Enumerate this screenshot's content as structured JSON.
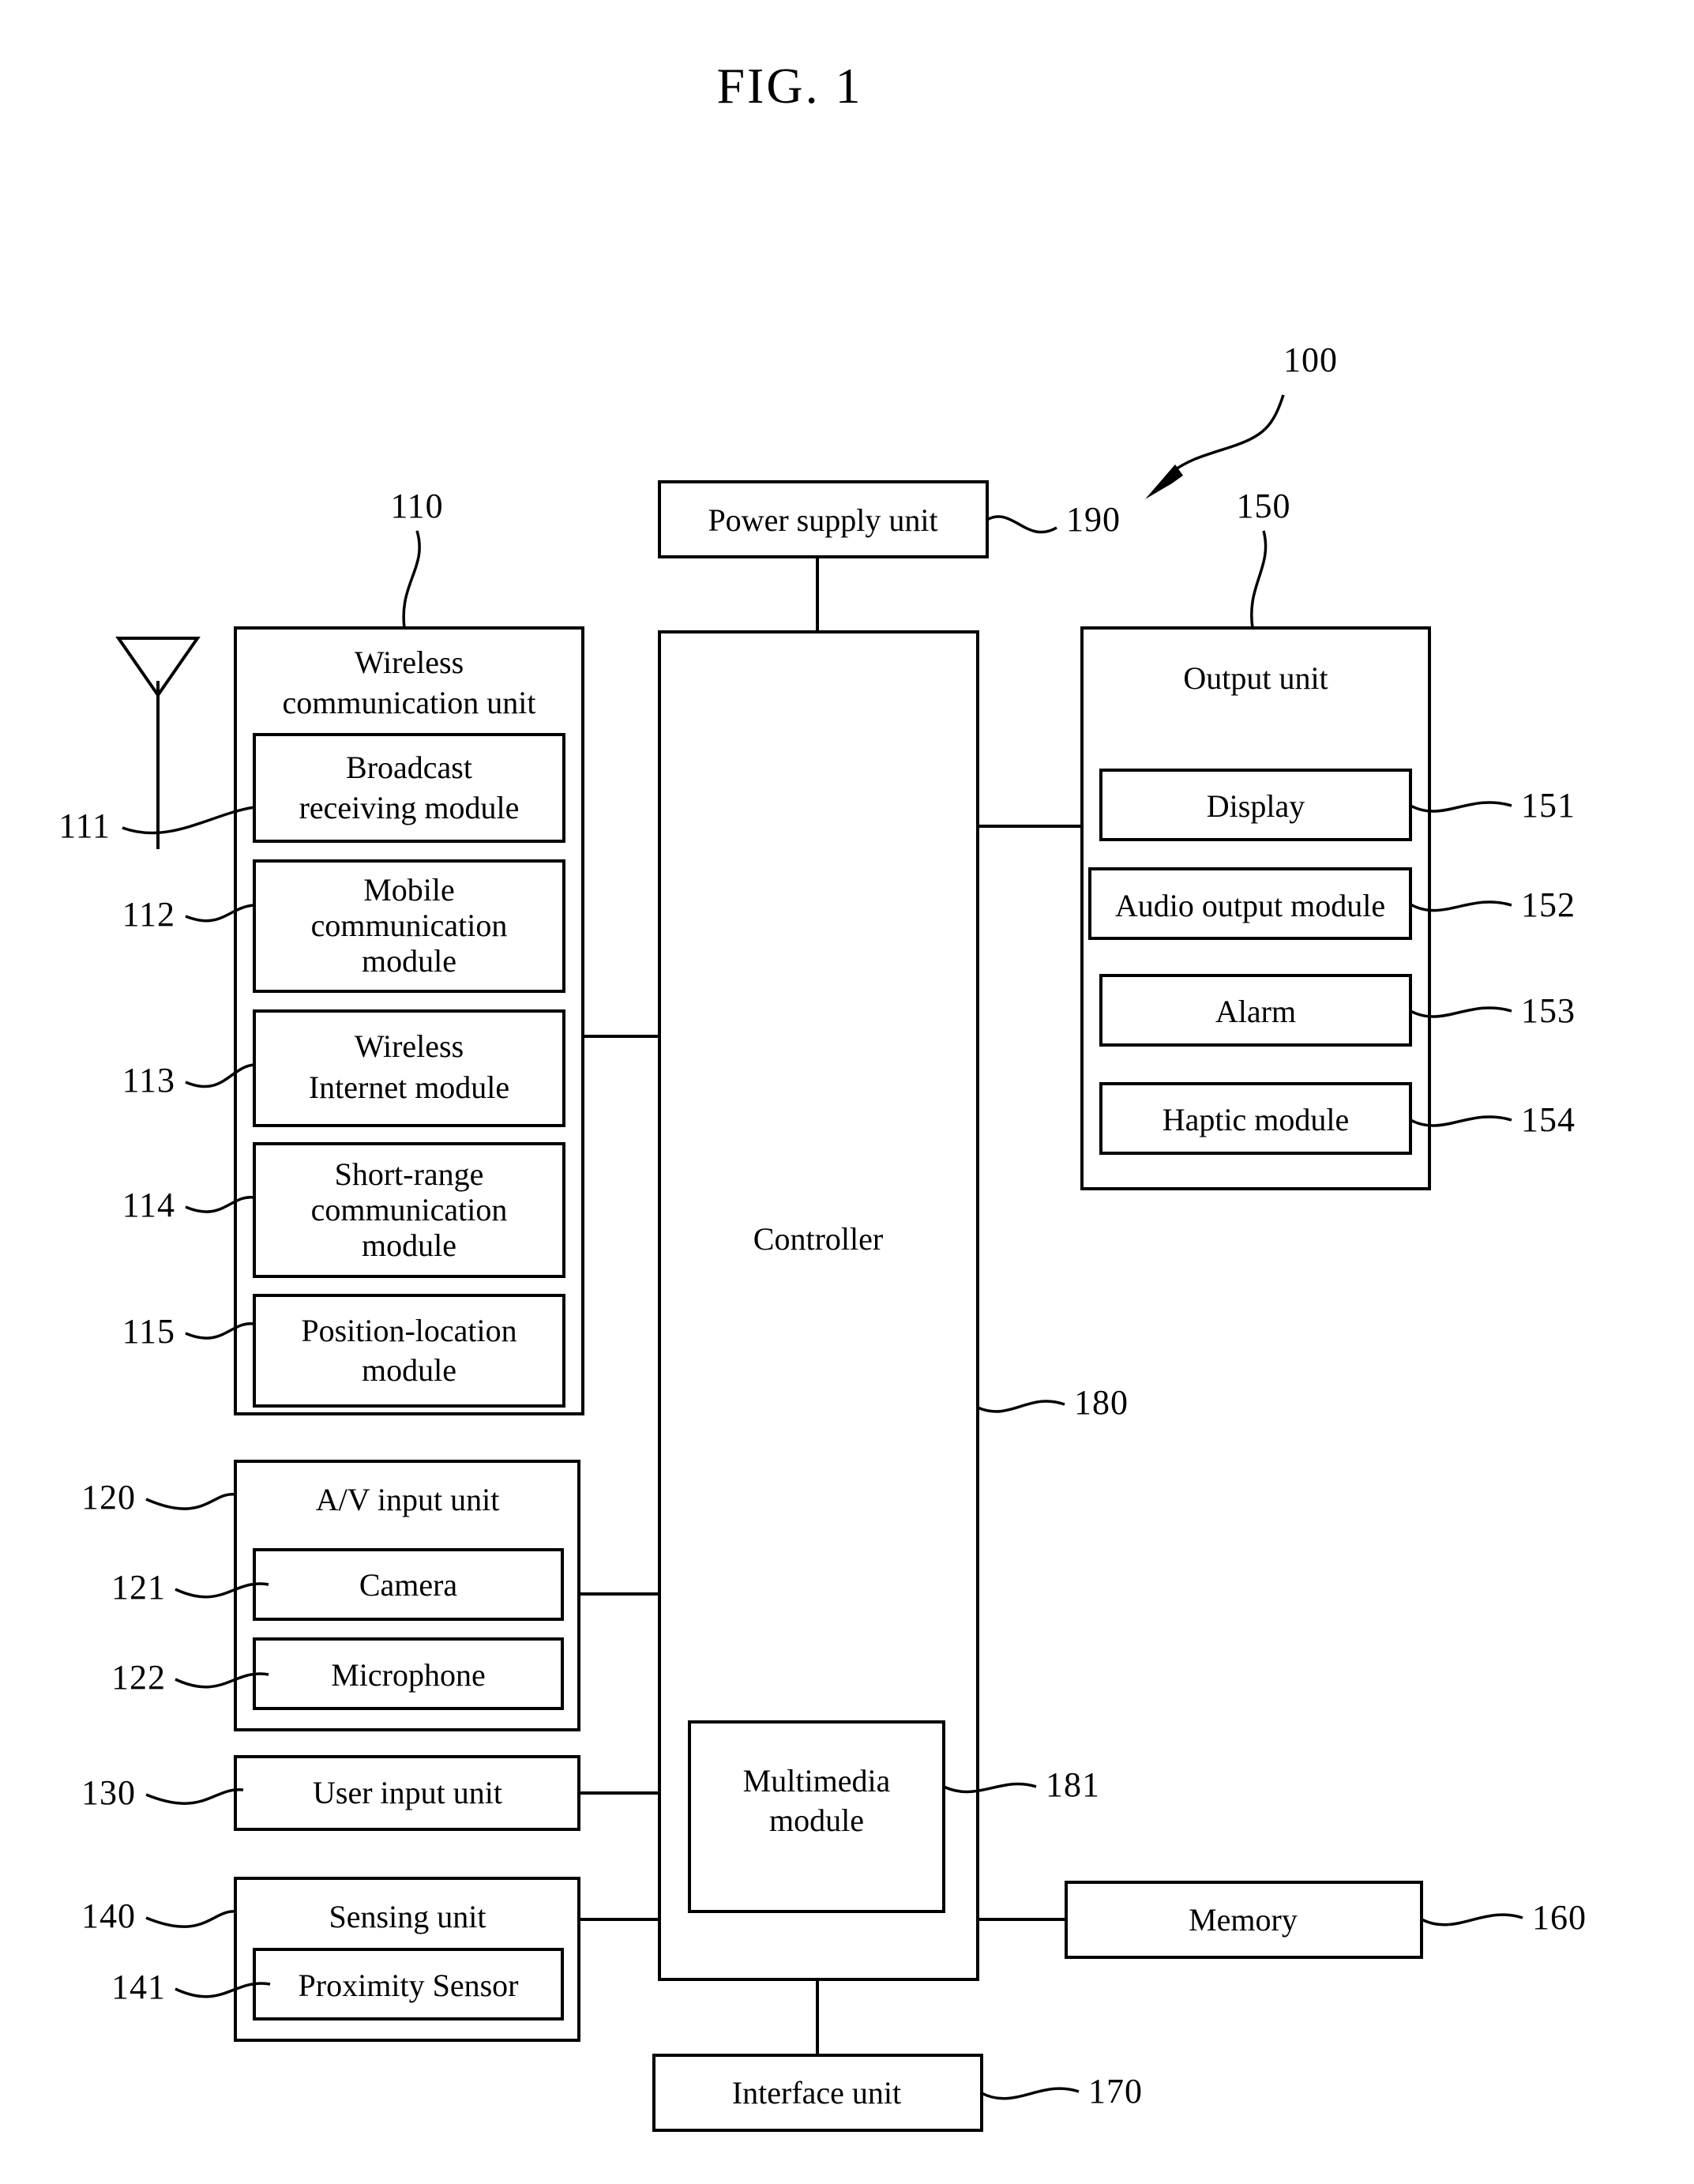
{
  "figure": {
    "title": "FIG. 1",
    "system_ref": "100"
  },
  "blocks": {
    "power_supply": {
      "label": "Power supply unit",
      "ref": "190"
    },
    "wireless_unit": {
      "label_line1": "Wireless",
      "label_line2": "communication unit",
      "ref": "110"
    },
    "broadcast": {
      "label_line1": "Broadcast",
      "label_line2": "receiving module",
      "ref": "111"
    },
    "mobile_comm": {
      "label_line1": "Mobile",
      "label_line2": "communication",
      "label_line3": "module",
      "ref": "112"
    },
    "wireless_internet": {
      "label_line1": "Wireless",
      "label_line2": "Internet module",
      "ref": "113"
    },
    "short_range": {
      "label_line1": "Short-range",
      "label_line2": "communication",
      "label_line3": "module",
      "ref": "114"
    },
    "position_location": {
      "label_line1": "Position-location",
      "label_line2": "module",
      "ref": "115"
    },
    "av_input": {
      "label": "A/V input unit",
      "ref": "120"
    },
    "camera": {
      "label": "Camera",
      "ref": "121"
    },
    "microphone": {
      "label": "Microphone",
      "ref": "122"
    },
    "user_input": {
      "label": "User input unit",
      "ref": "130"
    },
    "sensing_unit": {
      "label": "Sensing unit",
      "ref": "140"
    },
    "proximity_sensor": {
      "label": "Proximity Sensor",
      "ref": "141"
    },
    "controller": {
      "label": "Controller",
      "ref": "180"
    },
    "multimedia": {
      "label_line1": "Multimedia",
      "label_line2": "module",
      "ref": "181"
    },
    "output_unit": {
      "label": "Output unit",
      "ref": "150"
    },
    "display": {
      "label": "Display",
      "ref": "151"
    },
    "audio_output": {
      "label": "Audio output module",
      "ref": "152"
    },
    "alarm": {
      "label": "Alarm",
      "ref": "153"
    },
    "haptic": {
      "label": "Haptic module",
      "ref": "154"
    },
    "memory": {
      "label": "Memory",
      "ref": "160"
    },
    "interface_unit": {
      "label": "Interface unit",
      "ref": "170"
    }
  },
  "icons": {
    "antenna": "antenna-icon"
  },
  "colors": {
    "ink": "#000000",
    "background": "#ffffff"
  }
}
